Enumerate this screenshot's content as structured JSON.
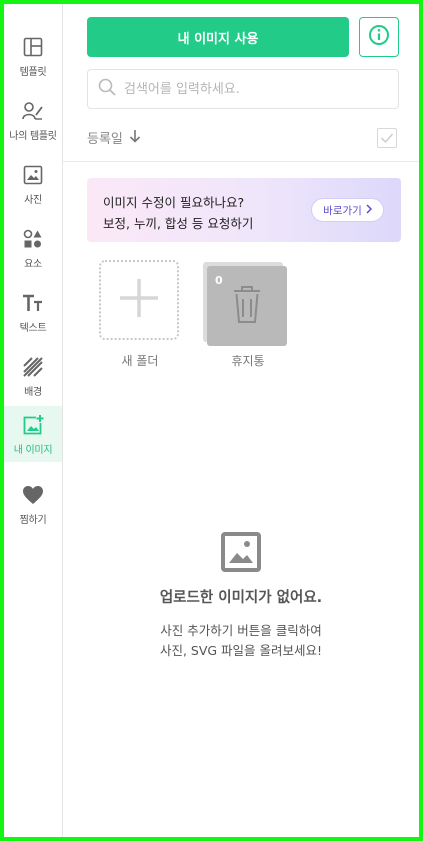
{
  "colors": {
    "accent": "#22cc88",
    "frame": "#14f514",
    "active_bg": "#e6f8f0"
  },
  "sidebar": {
    "items": [
      {
        "label": "템플릿",
        "icon": "template-icon"
      },
      {
        "label": "나의 템플릿",
        "icon": "my-template-icon"
      },
      {
        "label": "사진",
        "icon": "photo-icon"
      },
      {
        "label": "요소",
        "icon": "elements-icon"
      },
      {
        "label": "텍스트",
        "icon": "text-icon"
      },
      {
        "label": "배경",
        "icon": "background-icon"
      },
      {
        "label": "내 이미지",
        "icon": "my-image-icon",
        "active": true
      },
      {
        "label": "찜하기",
        "icon": "heart-icon"
      }
    ]
  },
  "toolbar": {
    "use_button": "내 이미지 사용",
    "info_icon": "info-icon"
  },
  "search": {
    "placeholder": "검색어를 입력하세요."
  },
  "sort": {
    "label": "등록일"
  },
  "banner": {
    "title": "이미지 수정이 필요하나요?",
    "subtitle": "보정, 누끼, 합성 등 요청하기",
    "button": "바로가기"
  },
  "folders": {
    "new_label": "새 폴더",
    "trash_label": "휴지통",
    "trash_count": "0"
  },
  "empty": {
    "title": "업로드한 이미지가 없어요.",
    "line1": "사진 추가하기 버튼을 클릭하여",
    "line2": "사진, SVG 파일을 올려보세요!"
  }
}
